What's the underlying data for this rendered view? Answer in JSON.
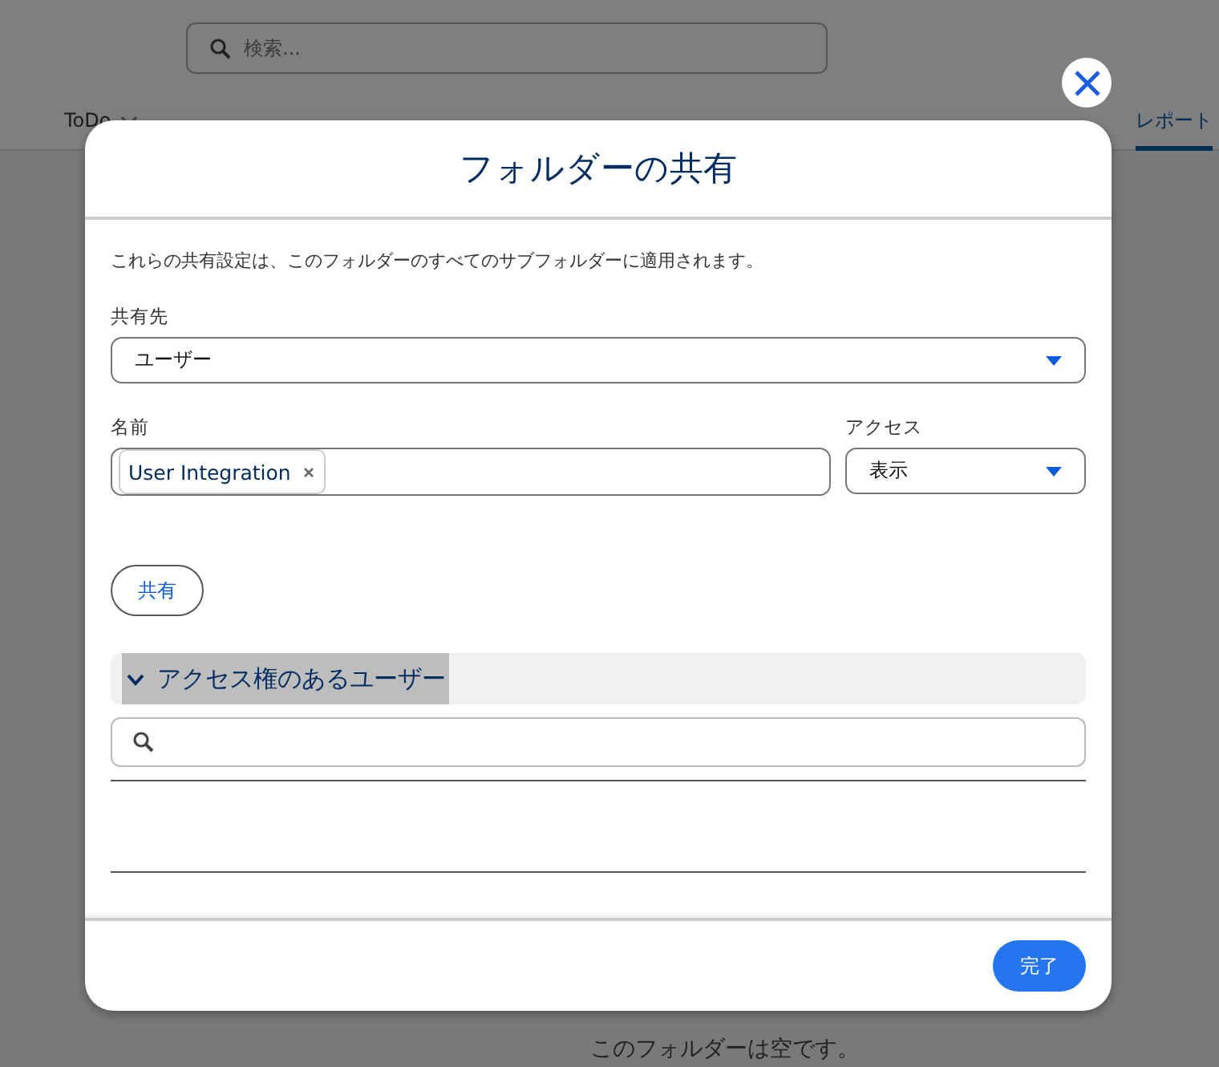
{
  "background": {
    "search": {
      "placeholder": "検索..."
    },
    "nav_tabs": [
      {
        "label": "ToDo",
        "selected": false
      },
      {
        "label": "レポート",
        "selected": true
      }
    ],
    "empty_message": "このフォルダーは空です。"
  },
  "dialog": {
    "title": "フォルダーの共有",
    "description": "これらの共有設定は、このフォルダーのすべてのサブフォルダーに適用されます。",
    "share_with": {
      "label": "共有先",
      "value": "ユーザー"
    },
    "name": {
      "label": "名前",
      "pills": [
        "User Integration"
      ]
    },
    "access": {
      "label": "アクセス",
      "value": "表示"
    },
    "share_button": "共有",
    "users_section": {
      "title": "アクセス権のあるユーザー",
      "expanded": true
    },
    "done_button": "完了"
  }
}
